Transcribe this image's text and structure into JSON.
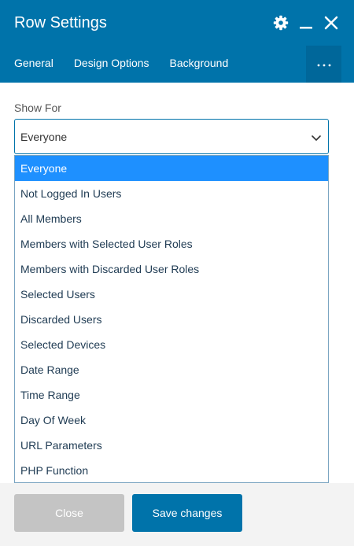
{
  "header": {
    "title": "Row Settings",
    "icons": [
      "gear-icon",
      "minimize-icon",
      "close-icon"
    ]
  },
  "tabs": [
    {
      "label": "General"
    },
    {
      "label": "Design Options"
    },
    {
      "label": "Background"
    }
  ],
  "more_button": {
    "icon": "more-dots-icon"
  },
  "show_for": {
    "label": "Show For",
    "selected": "Everyone",
    "options": [
      "Everyone",
      "Not Logged In Users",
      "All Members",
      "Members with Selected User Roles",
      "Members with Discarded User Roles",
      "Selected Users",
      "Discarded Users",
      "Selected Devices",
      "Date Range",
      "Time Range",
      "Day Of Week",
      "URL Parameters",
      "PHP Function"
    ]
  },
  "footer": {
    "close_label": "Close",
    "save_label": "Save changes"
  },
  "colors": {
    "header_bg": "#0073aa",
    "more_bg": "#00679a",
    "selected_option": "#1e90ff",
    "close_button": "#c4c4c4",
    "save_button": "#0073aa"
  }
}
